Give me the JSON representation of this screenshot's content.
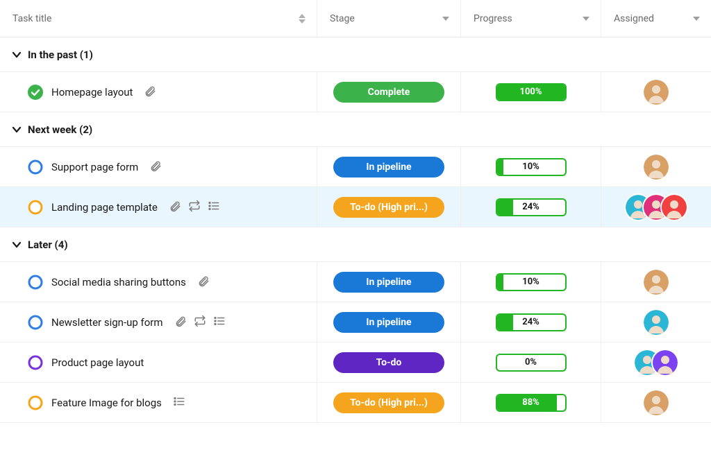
{
  "columns": {
    "task_title": "Task title",
    "stage": "Stage",
    "progress": "Progress",
    "assigned": "Assigned"
  },
  "colors": {
    "green": "#3bb24a",
    "blue": "#1a78d6",
    "orange": "#f5a51d",
    "purple": "#6026c4",
    "progress_green": "#22b722",
    "status_ring_blue": "#2f7de6",
    "status_ring_orange": "#f5a51d",
    "status_ring_purple": "#7a2fe0",
    "avatar_bg_1": "#d9a066",
    "avatar_bg_2": "#2bb6d6",
    "avatar_bg_3": "#e0307a",
    "avatar_bg_4": "#f04040",
    "avatar_bg_5": "#7a42f0"
  },
  "groups": [
    {
      "label": "In the past (1)",
      "tasks": [
        {
          "title": "Homepage layout",
          "status_type": "complete",
          "status_ring_color_key": "green",
          "icons": [
            "attachment"
          ],
          "stage_label": "Complete",
          "stage_color_key": "green",
          "progress_value": 100,
          "progress_label": "100%",
          "progress_color_key": "progress_green",
          "assignees": [
            {
              "bg_key": "avatar_bg_1"
            }
          ],
          "highlight": false
        }
      ]
    },
    {
      "label": "Next week (2)",
      "tasks": [
        {
          "title": "Support page form",
          "status_type": "open",
          "status_ring_color_key": "status_ring_blue",
          "icons": [
            "attachment"
          ],
          "stage_label": "In pipeline",
          "stage_color_key": "blue",
          "progress_value": 10,
          "progress_label": "10%",
          "progress_color_key": "progress_green",
          "assignees": [
            {
              "bg_key": "avatar_bg_1"
            }
          ],
          "highlight": false
        },
        {
          "title": "Landing page template",
          "status_type": "open",
          "status_ring_color_key": "status_ring_orange",
          "icons": [
            "attachment",
            "repeat",
            "list"
          ],
          "stage_label": "To-do (High pri...)",
          "stage_color_key": "orange",
          "progress_value": 24,
          "progress_label": "24%",
          "progress_color_key": "progress_green",
          "assignees": [
            {
              "bg_key": "avatar_bg_2"
            },
            {
              "bg_key": "avatar_bg_3"
            },
            {
              "bg_key": "avatar_bg_4"
            }
          ],
          "highlight": true
        }
      ]
    },
    {
      "label": "Later (4)",
      "tasks": [
        {
          "title": "Social media sharing buttons",
          "status_type": "open",
          "status_ring_color_key": "status_ring_blue",
          "icons": [
            "attachment"
          ],
          "stage_label": "In pipeline",
          "stage_color_key": "blue",
          "progress_value": 10,
          "progress_label": "10%",
          "progress_color_key": "progress_green",
          "assignees": [
            {
              "bg_key": "avatar_bg_1"
            }
          ],
          "highlight": false
        },
        {
          "title": "Newsletter sign-up form",
          "status_type": "open",
          "status_ring_color_key": "status_ring_blue",
          "icons": [
            "attachment",
            "repeat",
            "list"
          ],
          "stage_label": "In pipeline",
          "stage_color_key": "blue",
          "progress_value": 24,
          "progress_label": "24%",
          "progress_color_key": "progress_green",
          "assignees": [
            {
              "bg_key": "avatar_bg_2"
            }
          ],
          "highlight": false
        },
        {
          "title": "Product page layout",
          "status_type": "open",
          "status_ring_color_key": "status_ring_purple",
          "icons": [],
          "stage_label": "To-do",
          "stage_color_key": "purple",
          "progress_value": 0,
          "progress_label": "0%",
          "progress_color_key": "progress_green",
          "assignees": [
            {
              "bg_key": "avatar_bg_2"
            },
            {
              "bg_key": "avatar_bg_5"
            }
          ],
          "highlight": false
        },
        {
          "title": "Feature Image for blogs",
          "status_type": "open",
          "status_ring_color_key": "status_ring_orange",
          "icons": [
            "list"
          ],
          "stage_label": "To-do (High pri...)",
          "stage_color_key": "orange",
          "progress_value": 88,
          "progress_label": "88%",
          "progress_color_key": "progress_green",
          "assignees": [
            {
              "bg_key": "avatar_bg_1"
            }
          ],
          "highlight": false
        }
      ]
    }
  ]
}
